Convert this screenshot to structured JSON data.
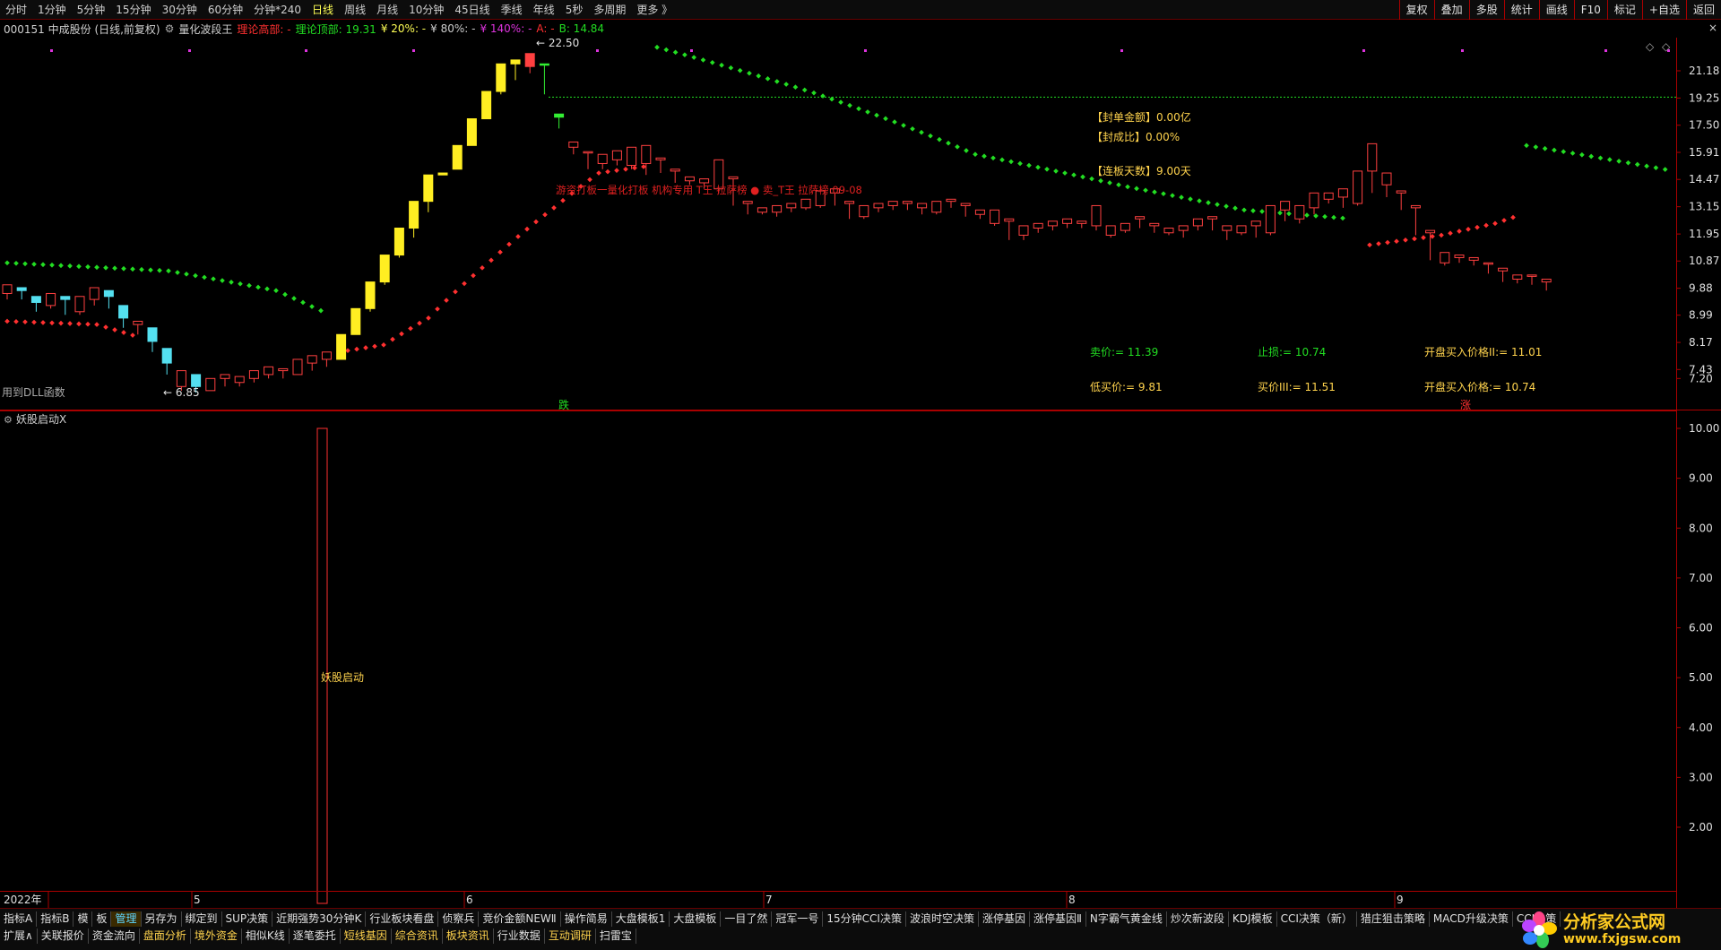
{
  "toolbar": {
    "periods": [
      "分时",
      "1分钟",
      "5分钟",
      "15分钟",
      "30分钟",
      "60分钟",
      "分钟*240",
      "日线",
      "周线",
      "月线",
      "10分钟",
      "45日线",
      "季线",
      "年线",
      "5秒",
      "多周期",
      "更多 》"
    ],
    "active_period": "日线",
    "tools": [
      "复权",
      "叠加",
      "多股",
      "统计",
      "画线",
      "F10",
      "标记",
      "+自选",
      "返回"
    ]
  },
  "info": {
    "stock": "000151 中成股份 (日线,前复权)",
    "indicator": "量化波段王",
    "label1": "理论高部: -",
    "label2": "理论顶部: 19.31",
    "label3": "¥ 20%: -",
    "label4": "¥ 80%: -",
    "label5": "¥ 140%: -",
    "label6": "A: -",
    "label7": "B: 14.84",
    "close": "×"
  },
  "main": {
    "price_axis": [
      "21.18",
      "19.25",
      "17.50",
      "15.91",
      "14.47",
      "13.15",
      "11.95",
      "10.87",
      "9.88",
      "8.99",
      "8.17",
      "7.43",
      "7.20"
    ],
    "high_label": "← 22.50",
    "low_label": "← 6.85",
    "dll_label": "用到DLL函数",
    "die_label": "跌",
    "zhang_label": "涨",
    "red_text": "游资打板一量化打板 机构专用 T王 拉萨榜 ● 卖_T王 拉萨榜   09-08",
    "panel": {
      "fengdan": "【封单金额】0.00亿",
      "fengcheng": "【封成比】0.00%",
      "lianban": "【连板天数】9.00天"
    },
    "levels": {
      "sell": "卖价:= 11.39",
      "low_buy": "低买价:= 9.81",
      "stop": "止损:= 10.74",
      "buy3": "买价III:= 11.51",
      "open2": "开盘买入价格II:= 11.01",
      "open1": "开盘买入价格:= 10.74"
    }
  },
  "sub": {
    "title": "妖股启动X",
    "axis": [
      "10.00",
      "9.00",
      "8.00",
      "7.00",
      "6.00",
      "5.00",
      "4.00",
      "3.00",
      "2.00"
    ],
    "bar_label": "妖股启动"
  },
  "dates": [
    "2022年",
    "5",
    "6",
    "7",
    "8",
    "9"
  ],
  "tabs": {
    "row1": [
      "指标A",
      "指标B",
      "模",
      "板",
      "管理",
      "另存为",
      "绑定到",
      "SUP决策",
      "近期强势30分钟K",
      "行业板块看盘",
      "侦察兵",
      "竞价金额NEWⅡ",
      "操作简易",
      "大盘模板1",
      "大盘模板",
      "一目了然",
      "冠军一号",
      "15分钟CCI决策",
      "波浪时空决策",
      "涨停基因",
      "涨停基因Ⅱ",
      "N字霸气黄金线",
      "炒次新波段",
      "KDJ模板",
      "CCI决策（新）",
      "猎庄狙击策略",
      "MACD升级决策",
      "CCI决策"
    ],
    "row2": [
      "扩展∧",
      "关联报价",
      "资金流向",
      "盘面分析",
      "境外资金",
      "相似K线",
      "逐笔委托",
      "短线基因",
      "综合资讯",
      "板块资讯",
      "行业数据",
      "互动调研",
      "扫雷宝"
    ],
    "row2_yellow": [
      "盘面分析",
      "境外资金",
      "短线基因",
      "综合资讯",
      "板块资讯",
      "互动调研"
    ]
  },
  "watermark": {
    "title": "分析家公式网",
    "url": "www.fxjgsw.com"
  },
  "chart_data": {
    "type": "candlestick",
    "candles": [
      [
        9.7,
        10.0,
        9.5,
        9.9
      ],
      [
        9.9,
        9.8,
        9.5,
        9.6
      ],
      [
        9.6,
        9.4,
        9.1,
        9.3
      ],
      [
        9.3,
        9.7,
        9.2,
        9.6
      ],
      [
        9.6,
        9.5,
        9.0,
        9.1
      ],
      [
        9.1,
        9.6,
        9.0,
        9.5
      ],
      [
        9.5,
        9.9,
        9.3,
        9.8
      ],
      [
        9.8,
        9.6,
        9.2,
        9.3
      ],
      [
        9.3,
        8.9,
        8.6,
        8.7
      ],
      [
        8.7,
        8.8,
        8.4,
        8.6
      ],
      [
        8.6,
        8.2,
        7.9,
        8.0
      ],
      [
        8.0,
        7.6,
        7.3,
        7.4
      ],
      [
        7.0,
        7.4,
        6.9,
        7.3
      ],
      [
        7.3,
        7.0,
        6.85,
        7.0
      ],
      [
        6.9,
        7.2,
        6.9,
        7.15
      ],
      [
        7.2,
        7.3,
        7.0,
        7.1
      ],
      [
        7.1,
        7.25,
        7.0,
        7.2
      ],
      [
        7.2,
        7.4,
        7.1,
        7.3
      ],
      [
        7.3,
        7.5,
        7.2,
        7.4
      ],
      [
        7.4,
        7.45,
        7.2,
        7.3
      ],
      [
        7.3,
        7.7,
        7.3,
        7.6
      ],
      [
        7.6,
        7.8,
        7.4,
        7.7
      ],
      [
        7.7,
        7.9,
        7.5,
        7.8
      ],
      [
        7.7,
        8.4,
        7.7,
        8.4
      ],
      [
        8.4,
        9.2,
        8.4,
        9.2
      ],
      [
        9.2,
        10.1,
        9.1,
        10.1
      ],
      [
        10.1,
        11.1,
        10.0,
        11.1
      ],
      [
        11.1,
        12.2,
        11.0,
        12.2
      ],
      [
        12.2,
        13.4,
        11.8,
        13.4
      ],
      [
        13.4,
        14.7,
        12.9,
        14.7
      ],
      [
        14.7,
        14.8,
        14.7,
        14.8
      ],
      [
        15.0,
        16.3,
        15.0,
        16.3
      ],
      [
        16.3,
        17.9,
        16.3,
        17.9
      ],
      [
        17.9,
        19.7,
        17.9,
        19.7
      ],
      [
        19.7,
        21.7,
        19.5,
        21.7
      ],
      [
        21.7,
        22.0,
        20.5,
        21.5
      ],
      [
        21.5,
        22.5,
        21.0,
        21.1
      ],
      [
        21.7,
        21.7,
        19.5,
        19.5
      ],
      [
        18.0,
        18.2,
        17.3,
        17.5
      ],
      [
        16.2,
        16.5,
        15.8,
        15.9
      ],
      [
        15.9,
        15.95,
        15.0,
        15.3
      ],
      [
        15.3,
        15.8,
        15.0,
        15.5
      ],
      [
        15.5,
        16.0,
        15.2,
        15.8
      ],
      [
        15.2,
        16.2,
        15.0,
        16.1
      ],
      [
        15.3,
        16.3,
        14.7,
        15.6
      ],
      [
        15.5,
        15.6,
        14.8,
        14.9
      ],
      [
        14.9,
        15.0,
        14.3,
        14.4
      ],
      [
        14.4,
        14.6,
        14.2,
        14.3
      ],
      [
        14.3,
        14.5,
        14.0,
        14.1
      ],
      [
        14.0,
        15.5,
        13.8,
        14.5
      ],
      [
        14.5,
        14.6,
        13.2,
        13.3
      ],
      [
        13.3,
        13.4,
        12.8,
        12.9
      ],
      [
        12.9,
        13.1,
        12.8,
        13.0
      ],
      [
        12.9,
        13.2,
        12.7,
        13.1
      ],
      [
        13.1,
        13.3,
        12.9,
        13.2
      ],
      [
        13.1,
        13.5,
        13.0,
        13.4
      ],
      [
        13.2,
        13.9,
        13.1,
        13.8
      ],
      [
        13.8,
        14.0,
        13.2,
        13.3
      ],
      [
        13.3,
        13.4,
        12.6,
        12.7
      ],
      [
        12.7,
        13.2,
        12.6,
        13.1
      ],
      [
        13.1,
        13.3,
        12.9,
        13.2
      ],
      [
        13.2,
        13.4,
        13.0,
        13.3
      ],
      [
        13.3,
        13.4,
        13.0,
        13.1
      ],
      [
        13.1,
        13.3,
        12.8,
        12.9
      ],
      [
        12.9,
        13.4,
        12.8,
        13.3
      ],
      [
        13.4,
        13.5,
        13.1,
        13.2
      ],
      [
        13.2,
        13.3,
        12.7,
        12.8
      ],
      [
        12.8,
        13.0,
        12.6,
        12.9
      ],
      [
        12.4,
        13.0,
        12.3,
        12.9
      ],
      [
        12.5,
        12.6,
        11.7,
        11.8
      ],
      [
        11.9,
        12.3,
        11.7,
        12.2
      ],
      [
        12.2,
        12.4,
        12.0,
        12.3
      ],
      [
        12.3,
        12.5,
        12.1,
        12.4
      ],
      [
        12.4,
        12.6,
        12.2,
        12.5
      ],
      [
        12.4,
        12.5,
        12.2,
        12.3
      ],
      [
        12.3,
        13.2,
        12.1,
        12.5
      ],
      [
        11.9,
        12.3,
        11.8,
        12.2
      ],
      [
        12.1,
        12.4,
        12.0,
        12.3
      ],
      [
        12.6,
        12.7,
        12.2,
        12.3
      ],
      [
        12.3,
        12.4,
        12.0,
        12.1
      ],
      [
        12.0,
        12.2,
        11.9,
        12.1
      ],
      [
        12.1,
        12.3,
        11.8,
        12.2
      ],
      [
        12.3,
        12.6,
        12.1,
        12.5
      ],
      [
        12.6,
        12.7,
        12.1,
        12.1
      ],
      [
        12.1,
        12.3,
        11.7,
        12.0
      ],
      [
        12.0,
        12.3,
        11.9,
        12.2
      ],
      [
        12.3,
        12.5,
        11.8,
        11.9
      ],
      [
        12.0,
        13.2,
        11.9,
        13.0
      ],
      [
        13.0,
        13.4,
        12.5,
        12.7
      ],
      [
        12.6,
        13.2,
        12.4,
        13.1
      ],
      [
        13.1,
        13.8,
        12.8,
        13.5
      ],
      [
        13.5,
        13.8,
        13.3,
        13.6
      ],
      [
        13.6,
        14.0,
        13.1,
        13.3
      ],
      [
        13.3,
        14.9,
        13.2,
        14.9
      ],
      [
        14.9,
        16.4,
        13.8,
        14.2
      ],
      [
        14.2,
        14.8,
        13.6,
        13.8
      ],
      [
        13.8,
        13.9,
        13.0,
        13.1
      ],
      [
        13.1,
        13.2,
        11.9,
        12.0
      ],
      [
        12.0,
        12.1,
        10.9,
        11.0
      ],
      [
        10.8,
        11.2,
        10.7,
        11.0
      ],
      [
        11.0,
        11.1,
        10.8,
        10.9
      ],
      [
        10.9,
        11.0,
        10.7,
        10.75
      ],
      [
        10.75,
        10.8,
        10.4,
        10.5
      ],
      [
        10.5,
        10.6,
        10.1,
        10.2
      ],
      [
        10.2,
        10.35,
        10.05,
        10.3
      ],
      [
        10.3,
        10.35,
        10.0,
        10.05
      ],
      [
        10.1,
        10.2,
        9.8,
        9.9
      ]
    ],
    "green_dots": [
      [
        0,
        10.8
      ],
      [
        108,
        9.0
      ],
      [
        180,
        8.7
      ],
      [
        220,
        23.0
      ],
      [
        300,
        21.6
      ],
      [
        365,
        20.6
      ],
      [
        445,
        19.6
      ],
      [
        520,
        18.9
      ],
      [
        605,
        16.1
      ],
      [
        690,
        14.9
      ],
      [
        770,
        14.1
      ],
      [
        840,
        13.4
      ],
      [
        900,
        13.05
      ],
      [
        940,
        12.8
      ],
      [
        980,
        12.6
      ]
    ],
    "green_dots_late": [
      [
        1008,
        16.3
      ],
      [
        1100,
        15.2
      ]
    ],
    "red_dots": [
      [
        0,
        8.8
      ],
      [
        108,
        8.6
      ],
      [
        160,
        7.6
      ],
      [
        210,
        8.3
      ],
      [
        260,
        10.2
      ],
      [
        305,
        12.4
      ],
      [
        340,
        14.0
      ],
      [
        390,
        15.3
      ],
      [
        440,
        15.6
      ]
    ],
    "red_dots_late": [
      [
        860,
        11.5
      ],
      [
        900,
        11.8
      ],
      [
        940,
        12.1
      ],
      [
        980,
        12.7
      ]
    ],
    "dash_level": 19.31,
    "sub_bar_value": 10.0
  }
}
